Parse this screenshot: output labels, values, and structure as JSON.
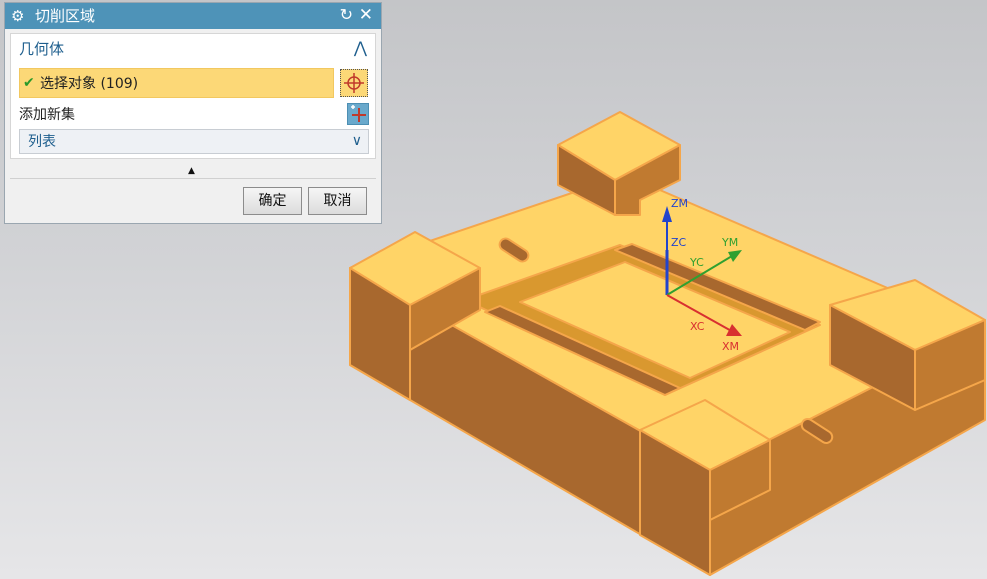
{
  "dialog": {
    "title": "切削区域",
    "icons": {
      "settings": "gear-icon",
      "reset": "reset-icon",
      "close": "close-icon"
    },
    "glyphs": {
      "gear": "⚙",
      "reset": "↻",
      "close": "✕",
      "collapse": "⋀",
      "expand": "∨",
      "more": "▲",
      "check": "✔"
    },
    "group": {
      "title": "几何体",
      "select_object_label": "选择对象 (109)",
      "add_new_set_label": "添加新集",
      "list_label": "列表"
    },
    "buttons": {
      "ok": "确定",
      "cancel": "取消"
    }
  },
  "viewport": {
    "axes": {
      "zm": "ZM",
      "zc": "ZC",
      "ym": "YM",
      "yc": "YC",
      "xc": "XC",
      "xm": "XM"
    },
    "colors": {
      "top": "#ffd467",
      "front": "#a8682e",
      "side": "#c8852f",
      "edge": "#f5a64a",
      "x_axis": "#d83030",
      "y_axis": "#30a030",
      "z_axis": "#2244cc"
    }
  }
}
